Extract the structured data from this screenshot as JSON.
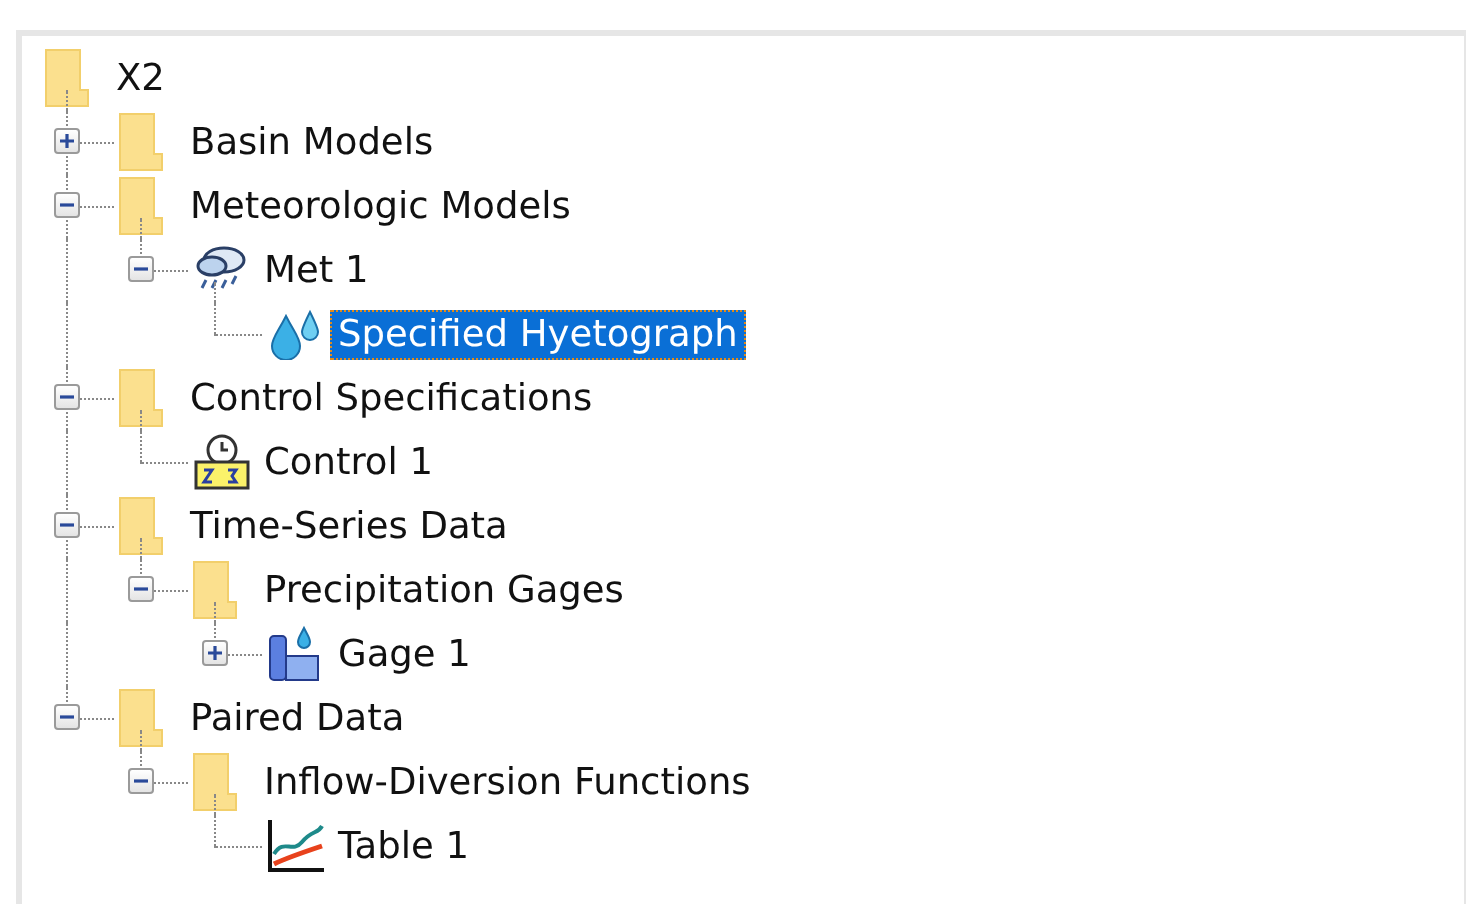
{
  "tree": [
    {
      "label": "X2",
      "kind": "folder",
      "selected": false,
      "children": [
        {
          "label": "Basin Models",
          "kind": "folder",
          "selected": false,
          "expanded": false
        },
        {
          "label": "Meteorologic Models",
          "kind": "folder",
          "selected": false,
          "expanded": true,
          "children": [
            {
              "label": "Met 1",
              "kind": "met",
              "selected": false,
              "expanded": true,
              "children": [
                {
                  "label": "Specified Hyetograph",
                  "kind": "precip",
                  "selected": true
                }
              ]
            }
          ]
        },
        {
          "label": "Control Specifications",
          "kind": "folder",
          "selected": false,
          "expanded": true,
          "children": [
            {
              "label": "Control 1",
              "kind": "control",
              "selected": false
            }
          ]
        },
        {
          "label": "Time-Series Data",
          "kind": "folder",
          "selected": false,
          "expanded": true,
          "children": [
            {
              "label": "Precipitation Gages",
              "kind": "folder",
              "selected": false,
              "expanded": true,
              "children": [
                {
                  "label": "Gage 1",
                  "kind": "gage",
                  "selected": false,
                  "expanded": false
                }
              ]
            }
          ]
        },
        {
          "label": "Paired Data",
          "kind": "folder",
          "selected": false,
          "expanded": true,
          "children": [
            {
              "label": "Inflow-Diversion Functions",
              "kind": "folder",
              "selected": false,
              "expanded": true,
              "children": [
                {
                  "label": "Table 1",
                  "kind": "table",
                  "selected": false
                }
              ]
            }
          ]
        }
      ]
    }
  ]
}
